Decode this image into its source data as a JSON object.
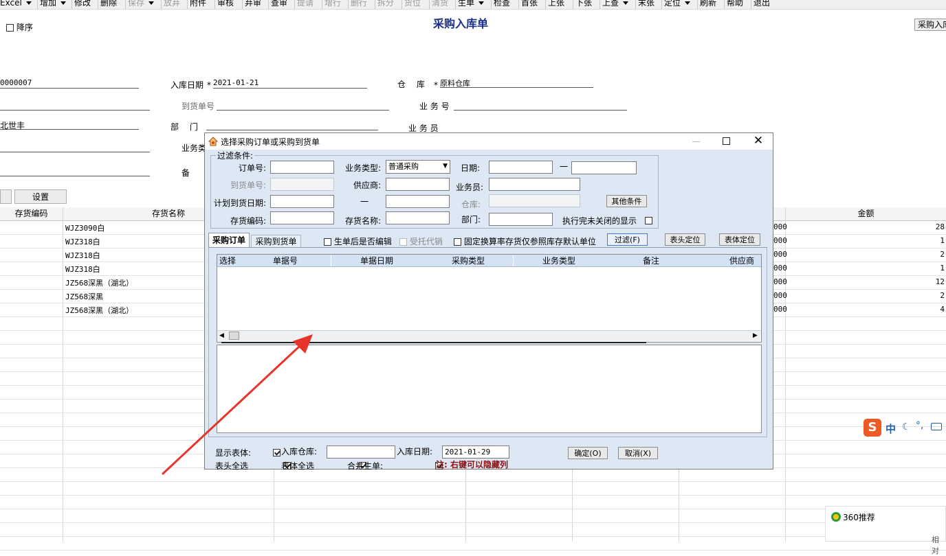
{
  "toolbar": {
    "items": [
      {
        "label": "Excel",
        "dropdown": true,
        "disabled": false
      },
      {
        "label": "增加",
        "dropdown": true,
        "disabled": false
      },
      {
        "label": "修改",
        "dropdown": false,
        "disabled": false
      },
      {
        "label": "删除",
        "dropdown": false,
        "disabled": false
      },
      {
        "label": "保存",
        "dropdown": true,
        "disabled": true
      },
      {
        "label": "放弃",
        "dropdown": false,
        "disabled": true
      },
      {
        "label": "附件",
        "dropdown": false,
        "disabled": false
      },
      {
        "label": "审核",
        "dropdown": false,
        "disabled": false
      },
      {
        "label": "弃审",
        "dropdown": false,
        "disabled": false
      },
      {
        "label": "查审",
        "dropdown": false,
        "disabled": false
      },
      {
        "label": "提请",
        "dropdown": false,
        "disabled": true
      },
      {
        "label": "增行",
        "dropdown": false,
        "disabled": true
      },
      {
        "label": "删行",
        "dropdown": false,
        "disabled": true
      },
      {
        "label": "拆分",
        "dropdown": false,
        "disabled": true
      },
      {
        "label": "货位",
        "dropdown": false,
        "disabled": true
      },
      {
        "label": "清货",
        "dropdown": false,
        "disabled": true
      },
      {
        "label": "生单",
        "dropdown": true,
        "disabled": false
      },
      {
        "label": "检查",
        "dropdown": false,
        "disabled": false
      },
      {
        "label": "首张",
        "dropdown": false,
        "disabled": false
      },
      {
        "label": "上张",
        "dropdown": false,
        "disabled": false
      },
      {
        "label": "下张",
        "dropdown": false,
        "disabled": false
      },
      {
        "label": "上查",
        "dropdown": true,
        "disabled": false
      },
      {
        "label": "末张",
        "dropdown": false,
        "disabled": false
      },
      {
        "label": "定位",
        "dropdown": true,
        "disabled": false
      },
      {
        "label": "刷新",
        "dropdown": false,
        "disabled": false
      },
      {
        "label": "帮助",
        "dropdown": false,
        "disabled": false
      },
      {
        "label": "退出",
        "dropdown": false,
        "disabled": false
      }
    ]
  },
  "page": {
    "title": "采购入库单",
    "desc_label": "降序",
    "right_button": "采购入库",
    "settings_button": "设置"
  },
  "header": {
    "doc_no_value": "0000007",
    "in_date_label": "入库日期",
    "in_date_value": "2021-01-21",
    "warehouse_label": "仓　 库",
    "warehouse_value": "原料仓库",
    "arrival_no_label": "到货单号",
    "business_no_label": "业 务 号",
    "supplier_value": "北世丰",
    "dept_label": "部　 门",
    "salesman_label": "业 务 员",
    "biz_type_label": "业务类",
    "remark_label": "备",
    "required_mark": "*"
  },
  "grid": {
    "columns": [
      "存货编码",
      "存货名称",
      "金额"
    ],
    "rows": [
      {
        "name": "WJZ3090白",
        "amount_prefix": "000",
        "amount": "28"
      },
      {
        "name": "WJZ318白",
        "amount_prefix": "000",
        "amount": "1"
      },
      {
        "name": "WJZ318白",
        "amount_prefix": "000",
        "amount": "2"
      },
      {
        "name": "WJZ318白",
        "amount_prefix": "000",
        "amount": "1"
      },
      {
        "name": "JZ568深黑（湖北）",
        "amount_prefix": "000",
        "amount": "12"
      },
      {
        "name": "JZ568深黑",
        "amount_prefix": "000",
        "amount": "2"
      },
      {
        "name": "JZ568深黑（湖北）",
        "amount_prefix": "000",
        "amount": "4"
      }
    ]
  },
  "dialog": {
    "title": "选择采购订单或采购到货单",
    "filter_group": "过滤条件:",
    "order_no_label": "订单号:",
    "biz_type_label": "业务类型:",
    "biz_type_value": "普通采购",
    "date_label": "日期:",
    "date_sep": "一",
    "arrival_no_label": "到货单号:",
    "supplier_label": "供应商:",
    "salesman_label": "业务员:",
    "plan_date_label": "计划到货日期:",
    "plan_date_sep": "一",
    "warehouse_label": "仓库:",
    "other_cond_button": "其他条件",
    "item_code_label": "存货编码:",
    "item_name_label": "存货名称:",
    "dept_label": "部门:",
    "show_closed_label": "执行完未关闭的显示",
    "tab_order": "采购订单",
    "tab_arrival": "采购到货单",
    "opt_edit_after": "生单后是否编辑",
    "opt_consign": "受托代销",
    "opt_fixed_rate": "固定换算率存货仅参照库存默认单位",
    "filter_button": "过滤(F)",
    "head_locate_button": "表头定位",
    "body_locate_button": "表体定位",
    "result_columns": [
      "选择",
      "单据号",
      "单据日期",
      "采购类型",
      "业务类型",
      "备注",
      "供应商"
    ],
    "show_body_label": "显示表体:",
    "in_warehouse_label": "入库仓库:",
    "in_date_label": "入库日期:",
    "in_date_value": "2021-01-29",
    "ok_button": "确定(O)",
    "cancel_button": "取消(X)",
    "head_all_label": "表头全选",
    "body_all_label": "表体全选",
    "merge_label": "合并生单:",
    "note": "注: 右键可以隐藏列"
  },
  "ime": {
    "lang": "中"
  },
  "recommend": {
    "title": "360推荐",
    "sub": "相对"
  }
}
